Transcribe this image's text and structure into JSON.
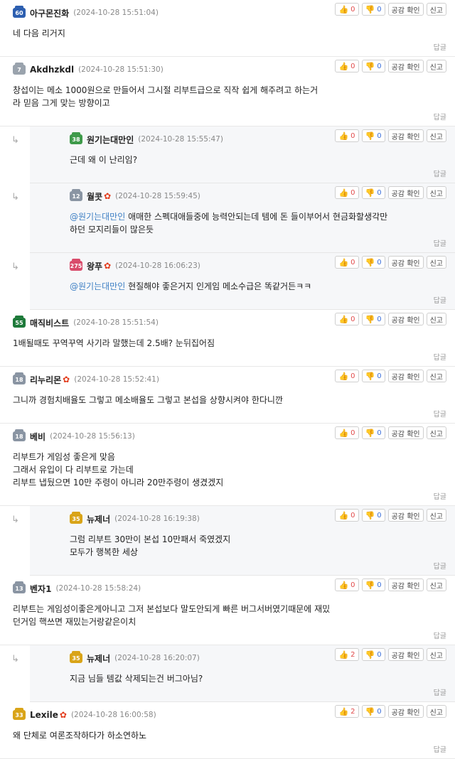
{
  "labels": {
    "reply": "답글",
    "empathy": "공감 확인",
    "report": "신고"
  },
  "comments": [
    {
      "nick": "아구몬진화",
      "level": "60",
      "level_color": "#2d5fb0",
      "date": "(2024-10-28 15:51:04)",
      "up": "0",
      "down": "0",
      "body": "네 다음 리거지",
      "maple": false,
      "mention": ""
    },
    {
      "nick": "Akdhzkdl",
      "level": "7",
      "level_color": "#9aa3ad",
      "date": "(2024-10-28 15:51:30)",
      "up": "0",
      "down": "0",
      "body": "창섭이는 메소 1000원으로 만들어서 그시절 리부트급으로 직작 쉽게 해주려고 하는거\n라 믿음 그게 맞는 방향이고",
      "maple": false,
      "mention": ""
    },
    {
      "nick": "원기는대만인",
      "level": "38",
      "level_color": "#3e9a4a",
      "date": "(2024-10-28 15:55:47)",
      "up": "0",
      "down": "0",
      "body": "근데 왜 이 난리임?",
      "maple": false,
      "mention": ""
    },
    {
      "nick": "월콧",
      "level": "12",
      "level_color": "#8a95a3",
      "date": "(2024-10-28 15:59:45)",
      "up": "0",
      "down": "0",
      "body": " 애매한 스펙대애들중에 능력안되는데 템에 돈 들이부어서 현금화할생각만\n하던 모지리들이 많은듯",
      "maple": true,
      "mention": "@원기는대만인"
    },
    {
      "nick": "왕푸",
      "level": "275",
      "level_color": "#d94c6c",
      "date": "(2024-10-28 16:06:23)",
      "up": "0",
      "down": "0",
      "body": " 현질해야 좋은거지 인게임 메소수급은 똑같거든ㅋㅋ",
      "maple": true,
      "mention": "@원기는대만인"
    },
    {
      "nick": "매직비스트",
      "level": "55",
      "level_color": "#1e7a3a",
      "date": "(2024-10-28 15:51:54)",
      "up": "0",
      "down": "0",
      "body": "1배될때도 꾸역꾸역 사기라 말했는데 2.5배? 눈뒤집어짐",
      "maple": false,
      "mention": ""
    },
    {
      "nick": "리누리몬",
      "level": "18",
      "level_color": "#8a95a3",
      "date": "(2024-10-28 15:52:41)",
      "up": "0",
      "down": "0",
      "body": "그니까 경험치배율도 그렇고 메소배율도 그렇고 본섭을 상향시켜야 한다니깐",
      "maple": true,
      "mention": ""
    },
    {
      "nick": "베비",
      "level": "18",
      "level_color": "#8a95a3",
      "date": "(2024-10-28 15:56:13)",
      "up": "0",
      "down": "0",
      "body": "리부트가 게임성 좋은게 맞음\n그래서 유입이 다 리부트로 가는데\n리부트 냅뒀으면 10만 주령이 아니라 20만주령이 생겼겠지",
      "maple": false,
      "mention": ""
    },
    {
      "nick": "뉴제너",
      "level": "35",
      "level_color": "#d9a418",
      "date": "(2024-10-28 16:19:38)",
      "up": "0",
      "down": "0",
      "body": "그럼 리부트 30만이 본섭 10만패서 죽였겠지\n모두가 행복한 세상",
      "maple": false,
      "mention": ""
    },
    {
      "nick": "벤자1",
      "level": "13",
      "level_color": "#8a95a3",
      "date": "(2024-10-28 15:58:24)",
      "up": "0",
      "down": "0",
      "body": "리부트는 게임성이좋은게아니고 그저 본섭보다 말도안되게 빠른 버그서버였기때문에 재밌\n던거임 핵쓰면 재밌는거랑같은이치",
      "maple": false,
      "mention": ""
    },
    {
      "nick": "뉴제너",
      "level": "35",
      "level_color": "#d9a418",
      "date": "(2024-10-28 16:20:07)",
      "up": "2",
      "down": "0",
      "body": "지금 님들 템값 삭제되는건 버그아님?",
      "maple": false,
      "mention": ""
    },
    {
      "nick": "Lexile",
      "level": "33",
      "level_color": "#d9a418",
      "date": "(2024-10-28 16:00:58)",
      "up": "2",
      "down": "0",
      "body": "왜 단체로 여론조작하다가 하소연하노",
      "maple": true,
      "mention": ""
    }
  ]
}
